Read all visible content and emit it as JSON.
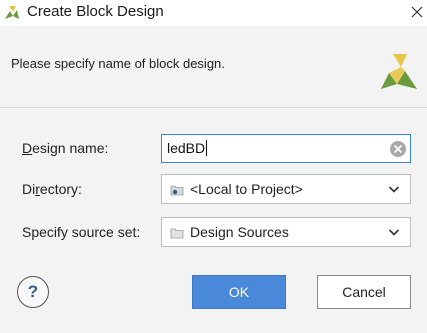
{
  "window": {
    "title": "Create Block Design",
    "close_icon": "close-icon",
    "logo_icon": "vivado-logo-icon"
  },
  "header": {
    "instruction": "Please specify name of block design.",
    "logo_icon": "vivado-logo-icon"
  },
  "form": {
    "design_name": {
      "label_mnemonic": "D",
      "label_rest": "esign name:",
      "value": "ledBD",
      "clear_icon": "clear-icon"
    },
    "directory": {
      "label_pre": "Di",
      "label_mnemonic": "r",
      "label_post": "ectory:",
      "value": "<Local to Project>",
      "icon": "project-folder-icon"
    },
    "source_set": {
      "label": "Specify source set:",
      "value": "Design Sources",
      "icon": "folder-icon"
    }
  },
  "buttons": {
    "help": "?",
    "ok": "OK",
    "cancel": "Cancel"
  },
  "colors": {
    "accent": "#4a88d9",
    "header_bg": "#f3f3f3",
    "logo_yellow": "#e8c547",
    "logo_green": "#6a9b3c"
  }
}
